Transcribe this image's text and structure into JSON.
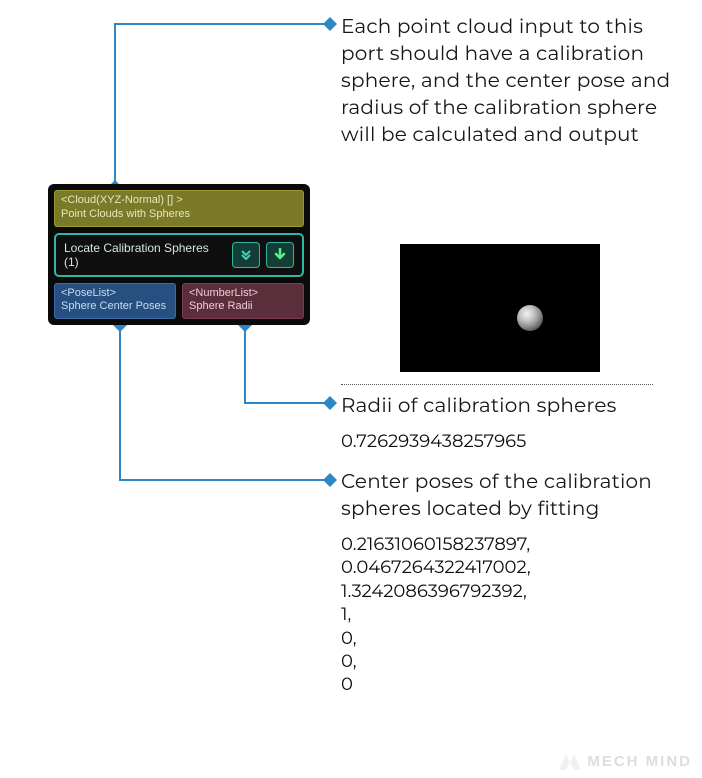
{
  "node": {
    "input_port": {
      "type_label": "<Cloud(XYZ-Normal) [] >",
      "name": "Point Clouds with Spheres"
    },
    "title": "Locate Calibration Spheres (1)",
    "btn_expand_icon": "chevron-double-down-icon",
    "btn_download_icon": "download-arrow-icon",
    "output_ports": {
      "pose": {
        "type_label": "<PoseList>",
        "name": "Sphere Center Poses"
      },
      "num": {
        "type_label": "<NumberList>",
        "name": "Sphere Radii"
      }
    }
  },
  "annotations": {
    "input": "Each point cloud input to this port should have a calibration sphere, and the center pose and radius of the calibration sphere will be calculated and output",
    "radii_label": "Radii of calibration spheres",
    "radii_value": "0.7262939438257965",
    "poses_label": "Center poses of the calibration spheres located by fitting",
    "poses_values": [
      "0.21631060158237897,",
      "0.0467264322417002,",
      "1.3242086396792392,",
      "1,",
      "0,",
      "0,",
      "0"
    ]
  },
  "preview_alt": "calibration-sphere-preview",
  "watermark": "MECH MIND",
  "colors": {
    "connector": "#2d86c5",
    "accent": "#2fb7a3"
  }
}
